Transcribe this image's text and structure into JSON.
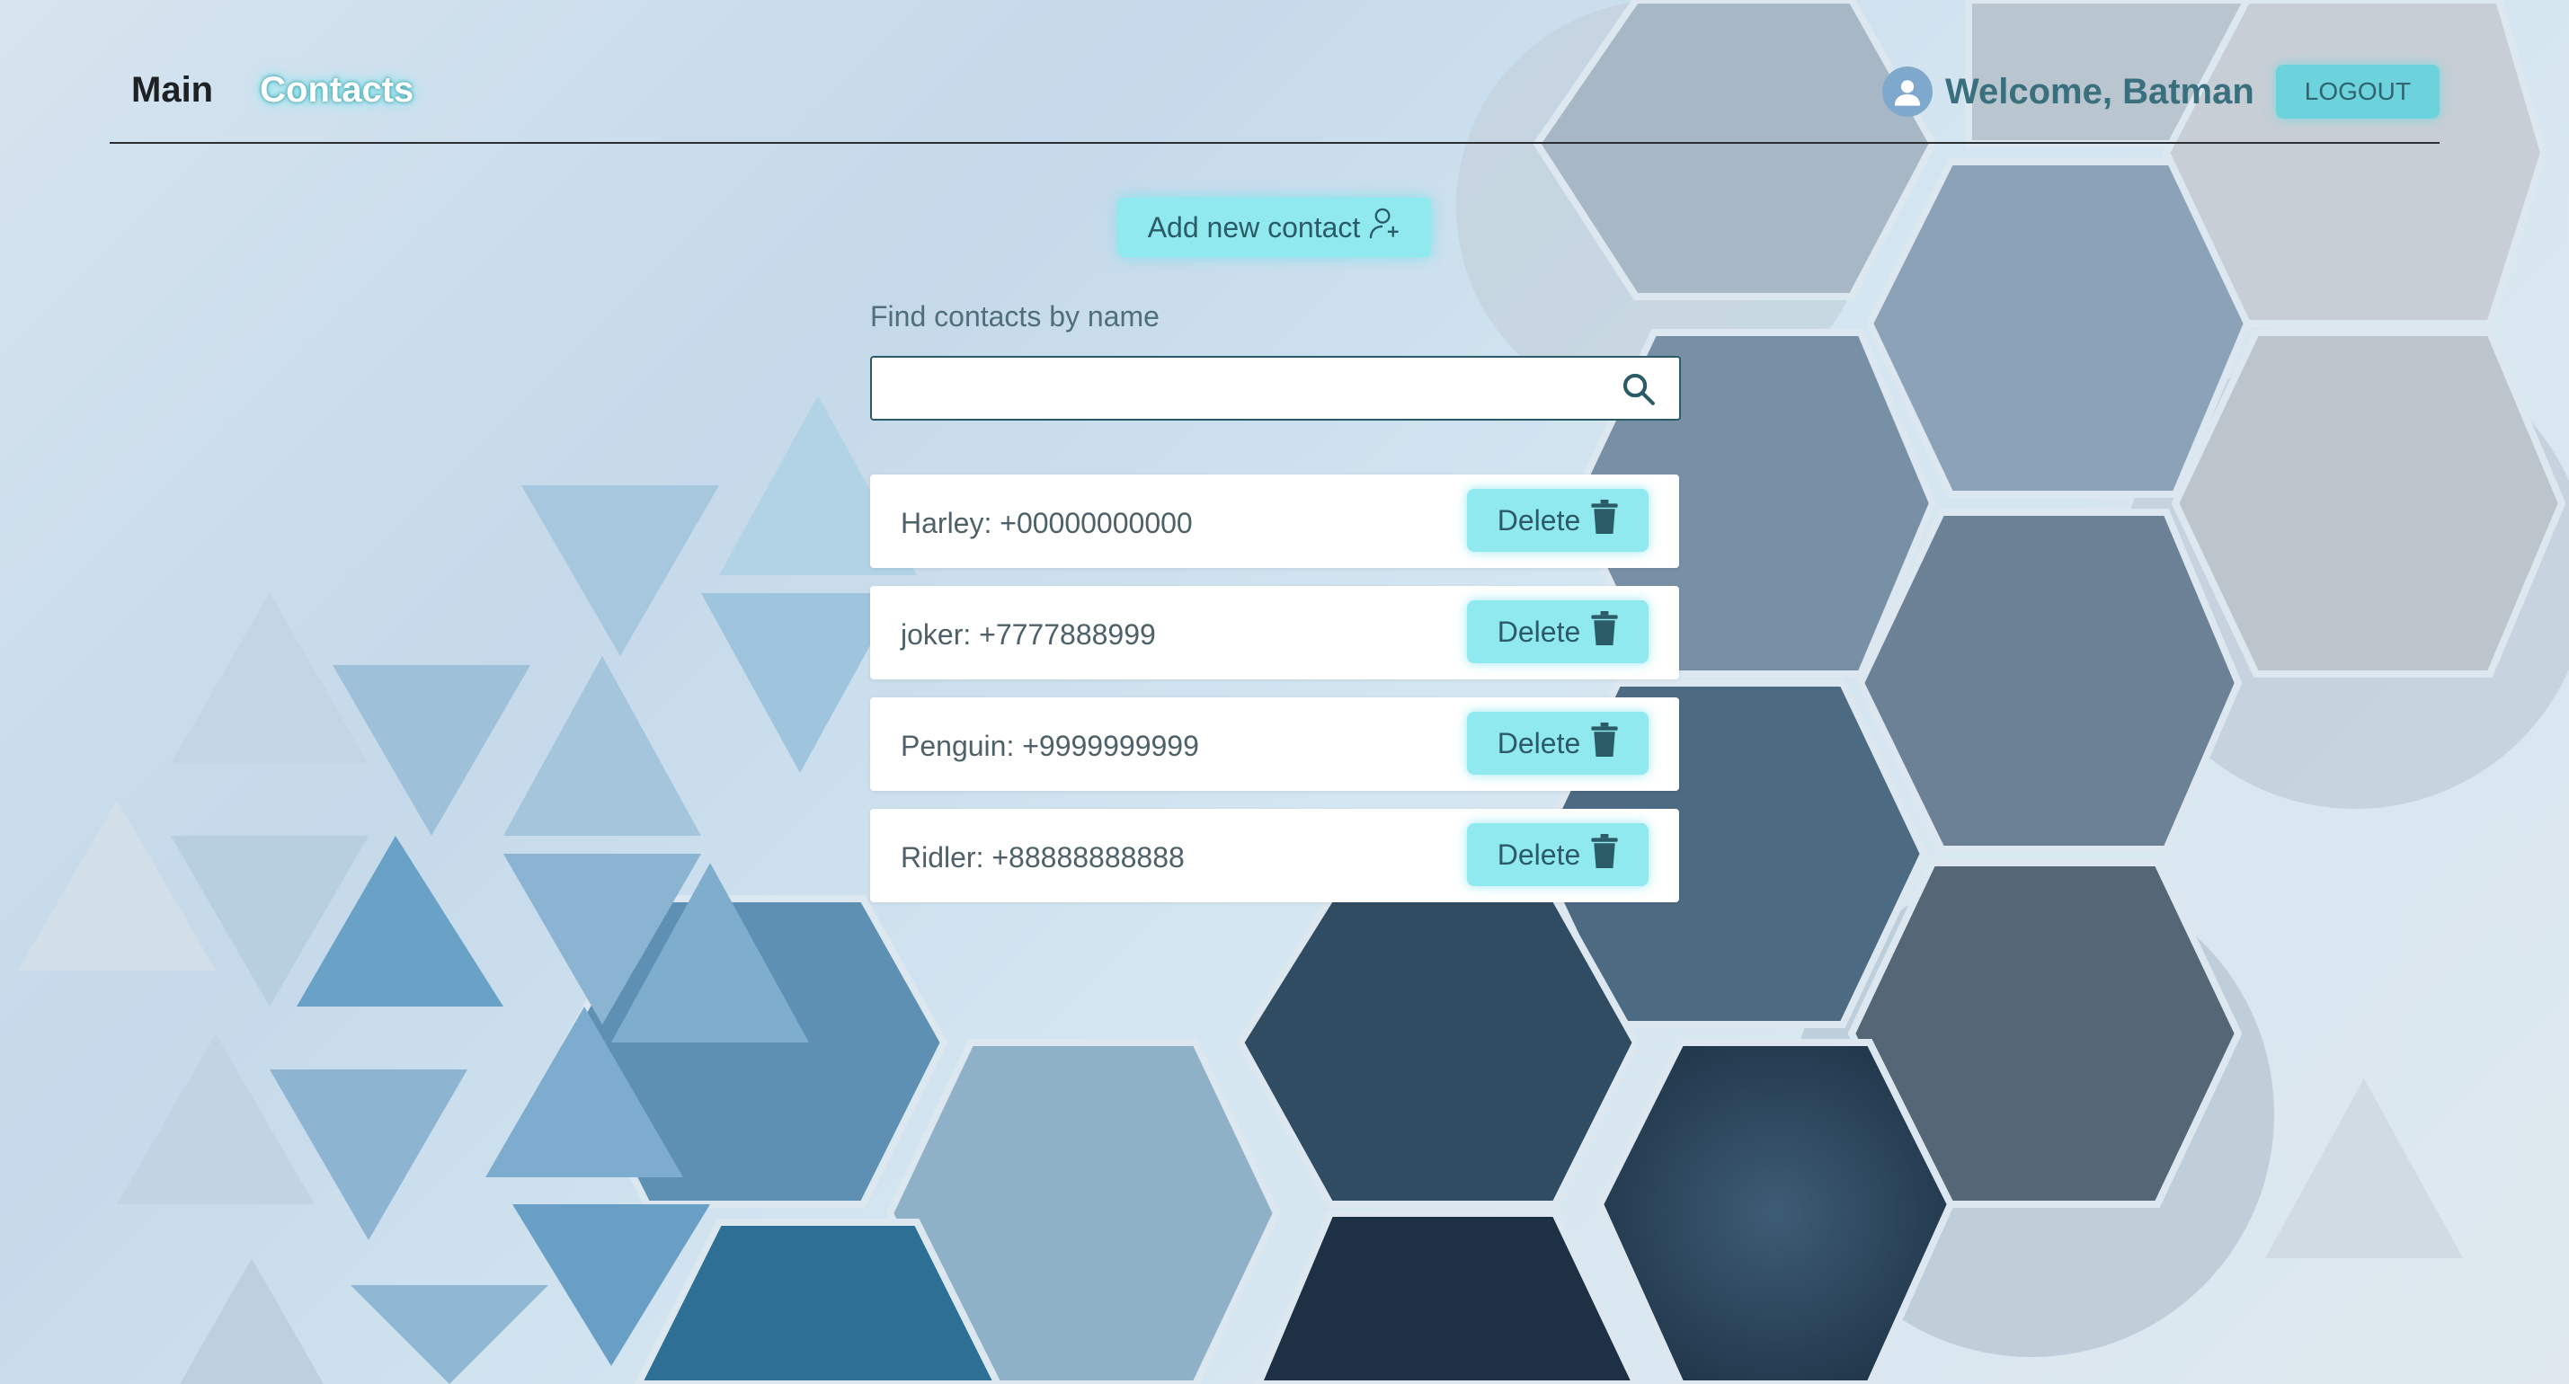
{
  "nav": {
    "main": "Main",
    "contacts": "Contacts"
  },
  "user": {
    "welcome": "Welcome, Batman",
    "logout": "LOGOUT"
  },
  "actions": {
    "add_contact": "Add new contact"
  },
  "search": {
    "label": "Find contacts by name",
    "value": ""
  },
  "contacts": [
    {
      "text": "Harley: +00000000000",
      "delete": "Delete"
    },
    {
      "text": "joker: +7777888999",
      "delete": "Delete"
    },
    {
      "text": "Penguin: +9999999999",
      "delete": "Delete"
    },
    {
      "text": "Ridler: +88888888888",
      "delete": "Delete"
    }
  ],
  "colors": {
    "accent": "#8fe9ef",
    "accent_text": "#2a5b66",
    "header_line": "#2b2f33",
    "welcome_text": "#3a6f7e"
  },
  "icons": {
    "avatar": "user-icon",
    "add_contact": "user-plus-icon",
    "search": "search-icon",
    "delete": "trash-icon"
  }
}
